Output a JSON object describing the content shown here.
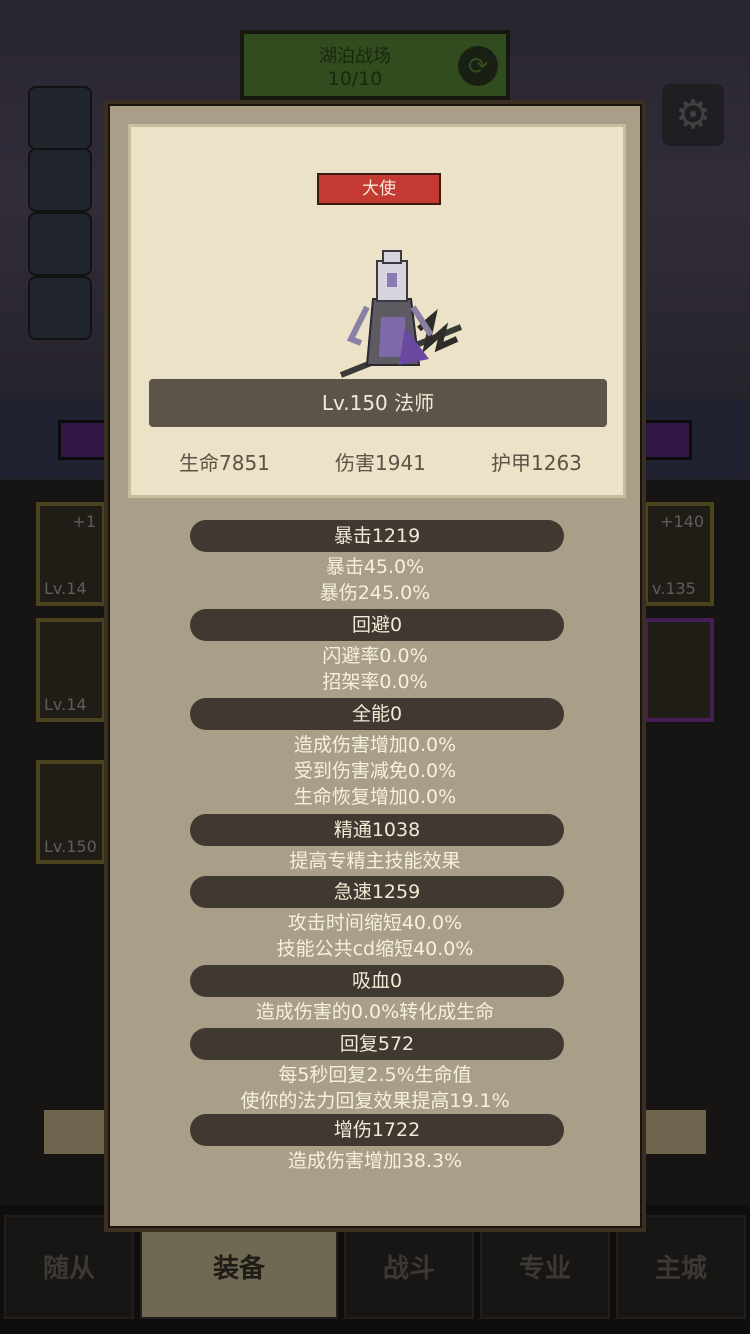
{
  "background": {
    "header_title": "湖泊战场",
    "header_progress": "10/10",
    "card_levels": [
      "Lv.14",
      "Lv.14",
      "Lv.150",
      "v.135"
    ],
    "card_bonus": [
      "+1",
      "+140"
    ],
    "nav": {
      "items": [
        {
          "label": "随从"
        },
        {
          "label": "装备"
        },
        {
          "label": "战斗"
        },
        {
          "label": "专业"
        },
        {
          "label": "主城"
        }
      ]
    }
  },
  "modal": {
    "rank_badge": "大使",
    "level_label": "Lv.150 法师",
    "stats": {
      "hp": "生命7851",
      "damage": "伤害1941",
      "armor": "护甲1263"
    },
    "sections": [
      {
        "header": "暴击1219",
        "lines": [
          "暴击45.0%",
          "暴伤245.0%"
        ]
      },
      {
        "header": "回避0",
        "lines": [
          "闪避率0.0%",
          "招架率0.0%"
        ]
      },
      {
        "header": "全能0",
        "lines": [
          "造成伤害增加0.0%",
          "受到伤害减免0.0%",
          "生命恢复增加0.0%"
        ]
      },
      {
        "header": "精通1038",
        "lines": [
          "提高专精主技能效果"
        ]
      },
      {
        "header": "急速1259",
        "lines": [
          "攻击时间缩短40.0%",
          "技能公共cd缩短40.0%"
        ]
      },
      {
        "header": "吸血0",
        "lines": [
          "造成伤害的0.0%转化成生命"
        ]
      },
      {
        "header": "回复572",
        "lines": [
          "每5秒回复2.5%生命值",
          "使你的法力回复效果提高19.1%"
        ]
      },
      {
        "header": "增伤1722",
        "lines": [
          "造成伤害增加38.3%"
        ]
      }
    ]
  },
  "colors": {
    "modal_bg": "#a99e87",
    "card_bg": "#ece2c8",
    "badge_red": "#c23a32",
    "header_pill": "#3f3932"
  }
}
